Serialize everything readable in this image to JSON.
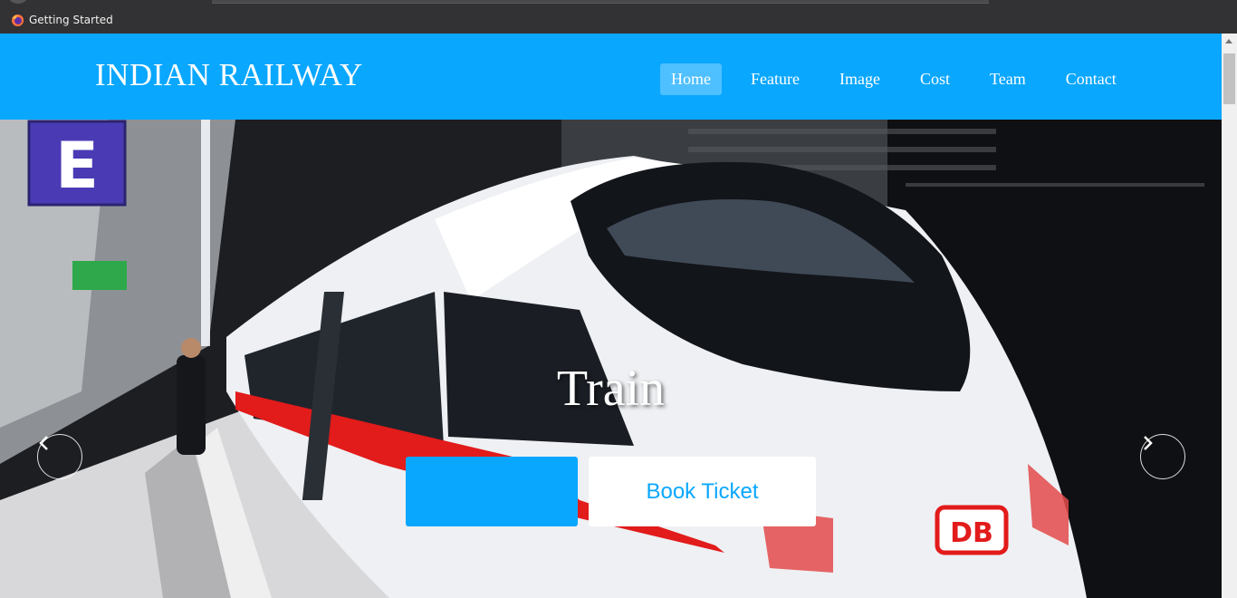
{
  "browser": {
    "bookmark_label": "Getting Started",
    "bookmark_icon": "firefox-icon"
  },
  "navbar": {
    "brand": "INDIAN RAILWAY",
    "items": [
      {
        "label": "Home",
        "active": true
      },
      {
        "label": "Feature",
        "active": false
      },
      {
        "label": "Image",
        "active": false
      },
      {
        "label": "Cost",
        "active": false
      },
      {
        "label": "Team",
        "active": false
      },
      {
        "label": "Contact",
        "active": false
      }
    ],
    "color": "#0aa7ff"
  },
  "hero": {
    "title": "Train",
    "primary_button_label": "",
    "secondary_button_label": "Book Ticket",
    "prev_icon": "chevron-left-icon",
    "next_icon": "chevron-right-icon",
    "platform_sign": "E",
    "train_logo": "DB"
  },
  "colors": {
    "accent": "#0aa7ff",
    "text_on_accent": "#ffffff"
  }
}
